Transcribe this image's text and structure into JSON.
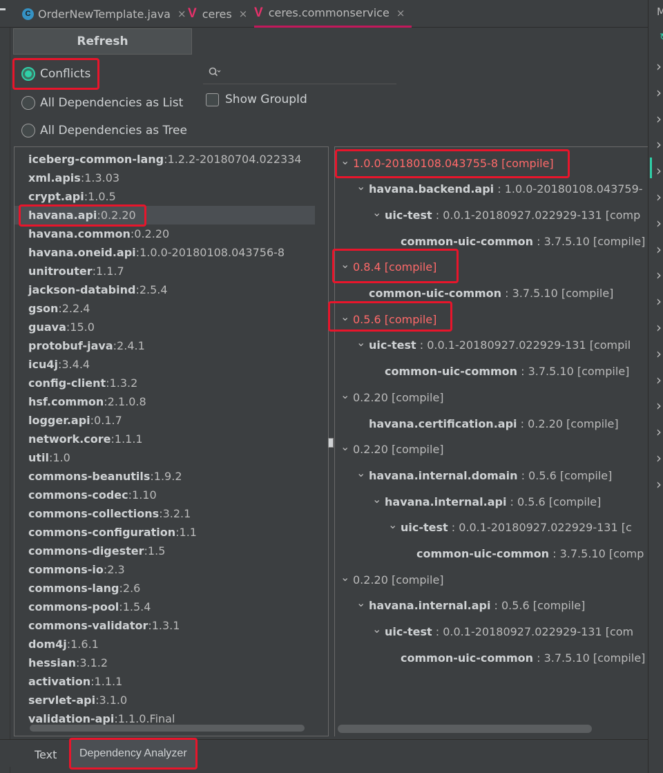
{
  "tabs": [
    {
      "label": "OrderNewTemplate.java",
      "icon": "java-class-icon",
      "active": false
    },
    {
      "label": "ceres",
      "icon": "maven-v-icon",
      "active": false
    },
    {
      "label": "ceres.commonservice",
      "icon": "maven-v-icon",
      "active": true
    }
  ],
  "tab_close_glyph": "×",
  "right_edge_letter": "M",
  "refresh_label": "Refresh",
  "view_modes": [
    {
      "label": "Conflicts",
      "selected": true
    },
    {
      "label": "All Dependencies as List",
      "selected": false
    },
    {
      "label": "All Dependencies as Tree",
      "selected": false
    }
  ],
  "search": {
    "value": "",
    "placeholder": ""
  },
  "show_groupid_label": "Show GroupId",
  "dependencies": [
    {
      "name": "iceberg-common-lang",
      "version": "1.2.2-20180704.022334"
    },
    {
      "name": "xml.apis",
      "version": "1.3.03"
    },
    {
      "name": "crypt.api",
      "version": "1.0.5"
    },
    {
      "name": "havana.api",
      "version": "0.2.20",
      "selected": true
    },
    {
      "name": "havana.common",
      "version": "0.2.20"
    },
    {
      "name": "havana.oneid.api",
      "version": "1.0.0-20180108.043756-8"
    },
    {
      "name": "unitrouter",
      "version": "1.1.7"
    },
    {
      "name": "jackson-databind",
      "version": "2.5.4"
    },
    {
      "name": "gson",
      "version": "2.2.4"
    },
    {
      "name": "guava",
      "version": "15.0"
    },
    {
      "name": "protobuf-java",
      "version": "2.4.1"
    },
    {
      "name": "icu4j",
      "version": "3.4.4"
    },
    {
      "name": "config-client",
      "version": "1.3.2"
    },
    {
      "name": "hsf.common",
      "version": "2.1.0.8"
    },
    {
      "name": "logger.api",
      "version": "0.1.7"
    },
    {
      "name": "network.core",
      "version": "1.1.1"
    },
    {
      "name": "util",
      "version": "1.0"
    },
    {
      "name": "commons-beanutils",
      "version": "1.9.2"
    },
    {
      "name": "commons-codec",
      "version": "1.10"
    },
    {
      "name": "commons-collections",
      "version": "3.2.1"
    },
    {
      "name": "commons-configuration",
      "version": "1.1"
    },
    {
      "name": "commons-digester",
      "version": "1.5"
    },
    {
      "name": "commons-io",
      "version": "2.3"
    },
    {
      "name": "commons-lang",
      "version": "2.6"
    },
    {
      "name": "commons-pool",
      "version": "1.5.4"
    },
    {
      "name": "commons-validator",
      "version": "1.3.1"
    },
    {
      "name": "dom4j",
      "version": "1.6.1"
    },
    {
      "name": "hessian",
      "version": "3.1.2"
    },
    {
      "name": "activation",
      "version": "1.1.1"
    },
    {
      "name": "servlet-api",
      "version": "3.1.0"
    },
    {
      "name": "validation-api",
      "version": "1.1.0.Final"
    }
  ],
  "tree": [
    {
      "level": 0,
      "chevron": true,
      "name": "",
      "detail": "1.0.0-20180108.043755-8 [compile]",
      "conflict": true
    },
    {
      "level": 1,
      "chevron": true,
      "name": "havana.backend.api",
      "detail": " : 1.0.0-20180108.043759-"
    },
    {
      "level": 2,
      "chevron": true,
      "name": "uic-test",
      "detail": " : 0.0.1-20180927.022929-131 [comp"
    },
    {
      "level": 3,
      "chevron": false,
      "name": "common-uic-common",
      "detail": " : 3.7.5.10 [compile]"
    },
    {
      "level": 0,
      "chevron": true,
      "name": "",
      "detail": "0.8.4 [compile]",
      "conflict": true
    },
    {
      "level": 1,
      "chevron": false,
      "name": "common-uic-common",
      "detail": " : 3.7.5.10 [compile]"
    },
    {
      "level": 0,
      "chevron": true,
      "name": "",
      "detail": "0.5.6 [compile]",
      "conflict": true
    },
    {
      "level": 1,
      "chevron": true,
      "name": "uic-test",
      "detail": " : 0.0.1-20180927.022929-131 [compil"
    },
    {
      "level": 2,
      "chevron": false,
      "name": "common-uic-common",
      "detail": " : 3.7.5.10 [compile]"
    },
    {
      "level": 0,
      "chevron": true,
      "name": "",
      "detail": "0.2.20 [compile]"
    },
    {
      "level": 1,
      "chevron": false,
      "name": "havana.certification.api",
      "detail": " : 0.2.20 [compile]"
    },
    {
      "level": 0,
      "chevron": true,
      "name": "",
      "detail": "0.2.20 [compile]"
    },
    {
      "level": 1,
      "chevron": true,
      "name": "havana.internal.domain",
      "detail": " : 0.5.6 [compile]"
    },
    {
      "level": 2,
      "chevron": true,
      "name": "havana.internal.api",
      "detail": " : 0.5.6 [compile]"
    },
    {
      "level": 3,
      "chevron": true,
      "name": "uic-test",
      "detail": " : 0.0.1-20180927.022929-131 [c"
    },
    {
      "level": 4,
      "chevron": false,
      "name": "common-uic-common",
      "detail": " : 3.7.5.10 [comp"
    },
    {
      "level": 0,
      "chevron": true,
      "name": "",
      "detail": "0.2.20 [compile]"
    },
    {
      "level": 1,
      "chevron": true,
      "name": "havana.internal.api",
      "detail": " : 0.5.6 [compile]"
    },
    {
      "level": 2,
      "chevron": true,
      "name": "uic-test",
      "detail": " : 0.0.1-20180927.022929-131 [com"
    },
    {
      "level": 3,
      "chevron": false,
      "name": "common-uic-common",
      "detail": " : 3.7.5.10 [compile]"
    }
  ],
  "bottom_tabs": [
    {
      "label": "Text",
      "active": false
    },
    {
      "label": "Dependency Analyzer",
      "active": true
    }
  ],
  "colors": {
    "background": "#3c3f41",
    "conflict_text": "#ff6a6a",
    "highlight_box": "#e8152b",
    "radio_accent": "#2fd0a8",
    "tab_active_underline": "#c2185b"
  }
}
